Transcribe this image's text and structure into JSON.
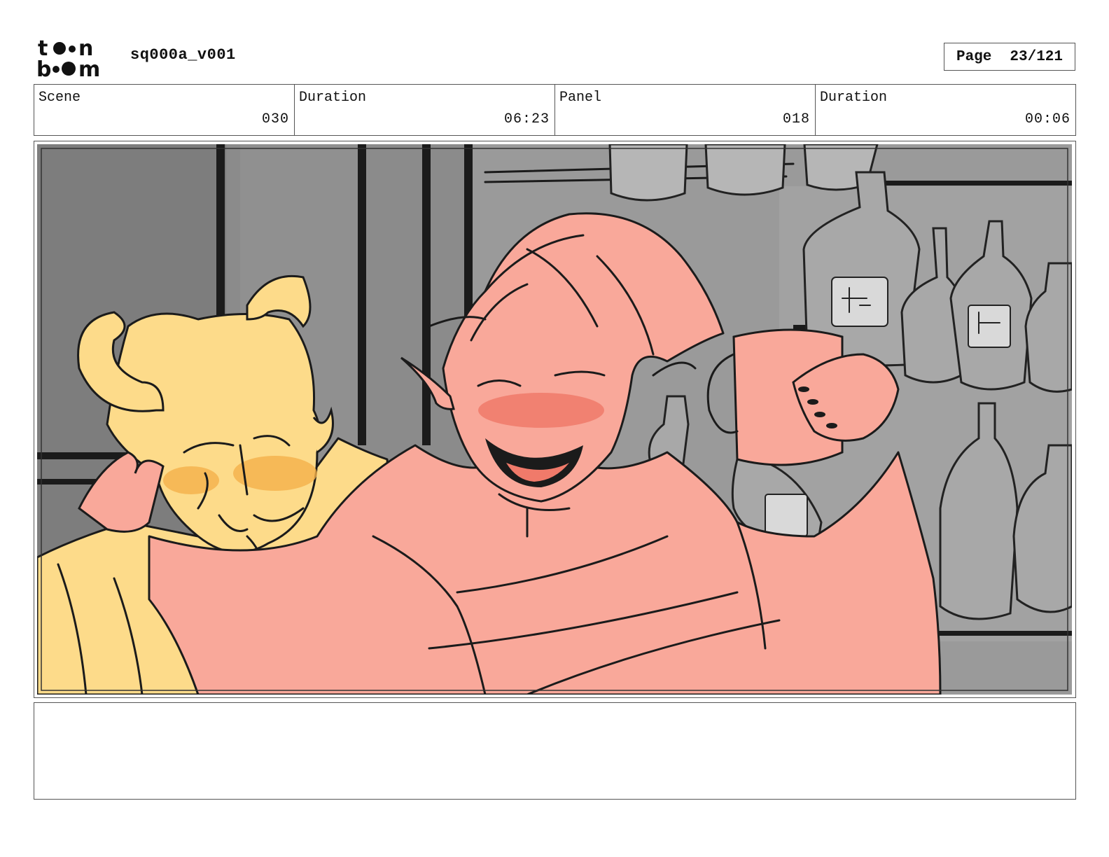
{
  "header": {
    "logo_text_top": "toon",
    "logo_text_bottom": "boom",
    "project_name": "sq000a_v001",
    "page_label": "Page",
    "page_number": "23/121"
  },
  "info_fields": [
    {
      "label": "Scene",
      "value": "030"
    },
    {
      "label": "Duration",
      "value": "06:23"
    },
    {
      "label": "Panel",
      "value": "018"
    },
    {
      "label": "Duration",
      "value": "00:06"
    }
  ],
  "colors": {
    "yellow_character": "#fddb8a",
    "pink_character": "#f9a89a",
    "blush": "#f07a6a",
    "background_gray": "#8a8a8a"
  },
  "notes": {
    "text": ""
  }
}
